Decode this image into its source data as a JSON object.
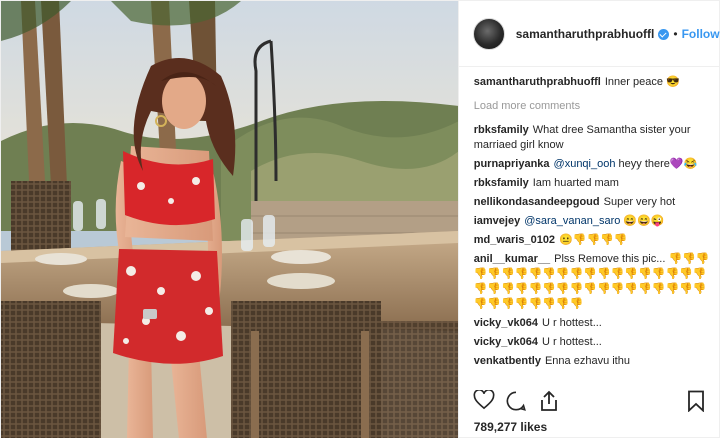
{
  "post": {
    "username": "samantharuthprabhuoffl",
    "follow_label": "Follow",
    "dot": "•",
    "caption": {
      "user": "samantharuthprabhuoffl",
      "text": "Inner peace 😎"
    },
    "load_more": "Load more comments",
    "comments": [
      {
        "user": "rbksfamily",
        "text": "What dree Samantha sister your marriaed girl know"
      },
      {
        "user": "purnapriyanka",
        "mention": "@xunqi_ooh",
        "text": " heyy there💜😂"
      },
      {
        "user": "rbksfamily",
        "text": "Iam huarted mam"
      },
      {
        "user": "nellikondasandeepgoud",
        "text": "Super very hot"
      },
      {
        "user": "iamvejey",
        "mention": "@sara_vanan_saro",
        "text": " 😄😄😜"
      },
      {
        "user": "md_waris_0102",
        "text": "😐👎👎👎👎"
      },
      {
        "user": "anil__kumar__",
        "text": "Plss Remove this pic... 👎👎👎👎👎👎👎👎👎👎👎👎👎👎👎👎👎👎👎👎👎👎👎👎👎👎👎👎👎👎👎👎👎👎👎👎👎👎👎👎👎👎👎👎👎"
      },
      {
        "user": "vicky_vk064",
        "text": "U r hottest..."
      },
      {
        "user": "vicky_vk064",
        "text": "U r hottest..."
      },
      {
        "user": "venkatbently",
        "text": "Enna ezhavu ithu"
      }
    ],
    "likes": "789,277 likes"
  },
  "icons": {
    "like": "heart-icon",
    "comment": "comment-icon",
    "share": "share-icon",
    "save": "bookmark-icon"
  },
  "colors": {
    "link": "#3897f0",
    "mention": "#003569",
    "muted": "#999999",
    "text": "#262626"
  }
}
